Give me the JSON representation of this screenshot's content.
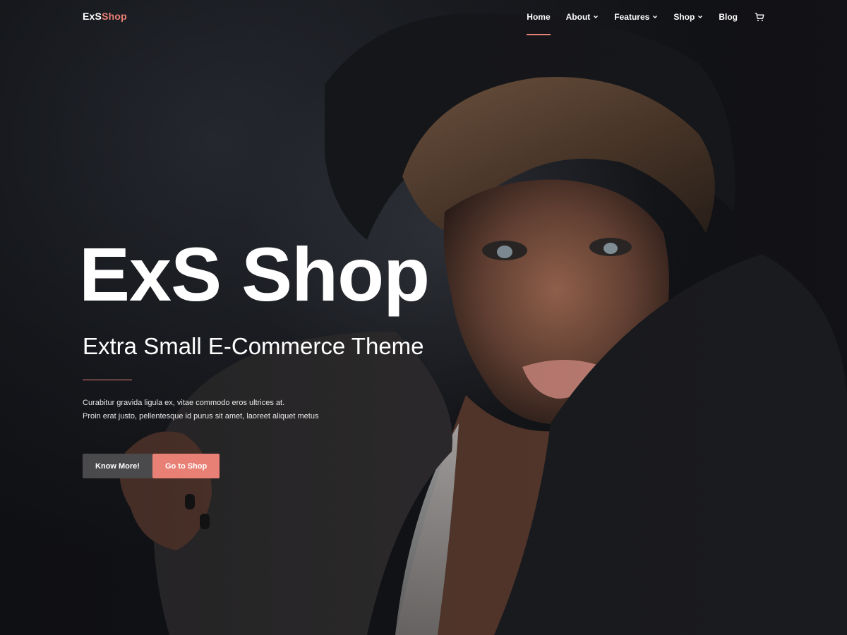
{
  "brand": {
    "part1": "ExS",
    "part2": "Shop",
    "accent_color": "#e98075"
  },
  "nav": {
    "items": [
      {
        "label": "Home",
        "dropdown": false,
        "active": true
      },
      {
        "label": "About",
        "dropdown": true,
        "active": false
      },
      {
        "label": "Features",
        "dropdown": true,
        "active": false
      },
      {
        "label": "Shop",
        "dropdown": true,
        "active": false
      },
      {
        "label": "Blog",
        "dropdown": false,
        "active": false
      }
    ],
    "cart_icon": "cart-icon"
  },
  "hero": {
    "title": "ExS Shop",
    "subtitle": "Extra Small E-Commerce Theme",
    "description_line1": "Curabitur gravida ligula ex, vitae commodo eros ultrices at.",
    "description_line2": "Proin erat justo, pellentesque id purus sit amet, laoreet aliquet metus",
    "buttons": {
      "primary_label": "Know More!",
      "secondary_label": "Go to Shop"
    }
  },
  "colors": {
    "accent": "#e98075",
    "button_dark": "#4a4a4c",
    "background": "#1a1c21"
  }
}
